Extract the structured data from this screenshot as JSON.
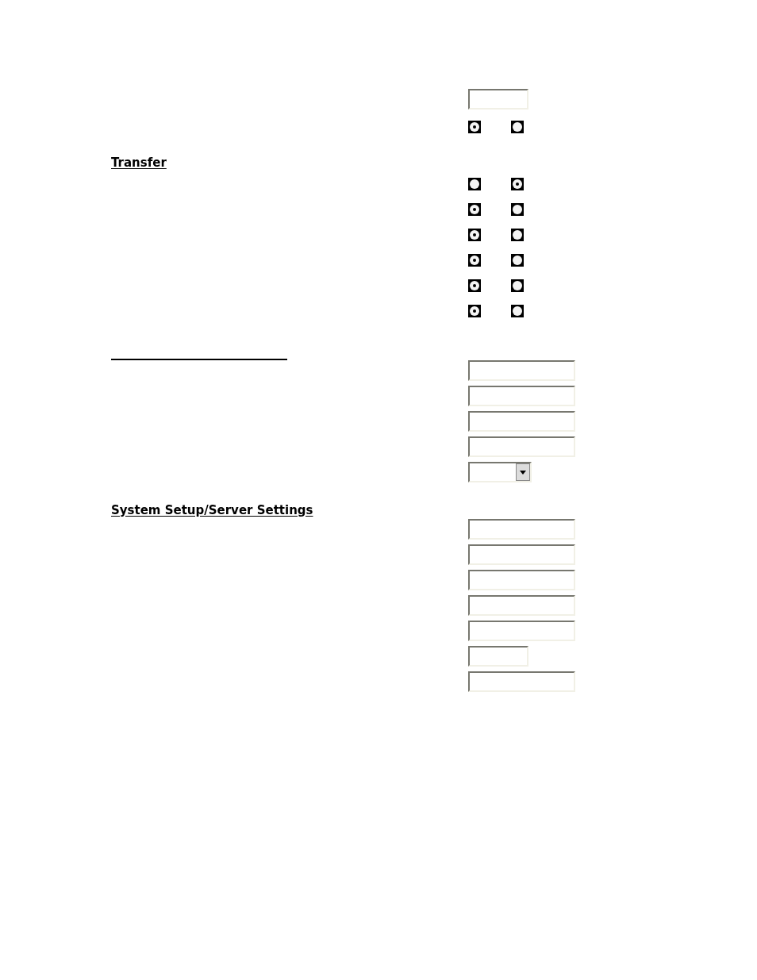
{
  "sections": [
    {
      "rows": [
        {
          "kind": "short_field"
        },
        {
          "kind": "radio_pair",
          "options": [
            {
              "selected": true
            },
            {
              "selected": false
            }
          ]
        }
      ]
    },
    {
      "heading": {
        "kind": "text",
        "text": "Transfer"
      },
      "rows": [
        {
          "kind": "radio_pair",
          "options": [
            {
              "selected": false
            },
            {
              "selected": true
            }
          ]
        },
        {
          "kind": "radio_pair",
          "options": [
            {
              "selected": true
            },
            {
              "selected": false
            }
          ]
        },
        {
          "kind": "radio_pair",
          "options": [
            {
              "selected": true
            },
            {
              "selected": false
            }
          ]
        },
        {
          "kind": "radio_pair",
          "options": [
            {
              "selected": true
            },
            {
              "selected": false
            }
          ]
        },
        {
          "kind": "radio_pair",
          "options": [
            {
              "selected": true
            },
            {
              "selected": false
            }
          ]
        },
        {
          "kind": "radio_pair",
          "options": [
            {
              "selected": true
            },
            {
              "selected": false
            }
          ]
        }
      ]
    },
    {
      "heading": {
        "kind": "blank_rule"
      },
      "rows": [
        {
          "kind": "field"
        },
        {
          "kind": "field"
        },
        {
          "kind": "field"
        },
        {
          "kind": "field"
        },
        {
          "kind": "dropdown"
        }
      ]
    },
    {
      "heading": {
        "kind": "text",
        "text": "System Setup/Server Settings"
      },
      "rows": [
        {
          "kind": "field"
        },
        {
          "kind": "field"
        },
        {
          "kind": "field"
        },
        {
          "kind": "field"
        },
        {
          "kind": "field"
        },
        {
          "kind": "short_field"
        },
        {
          "kind": "field"
        }
      ]
    }
  ]
}
